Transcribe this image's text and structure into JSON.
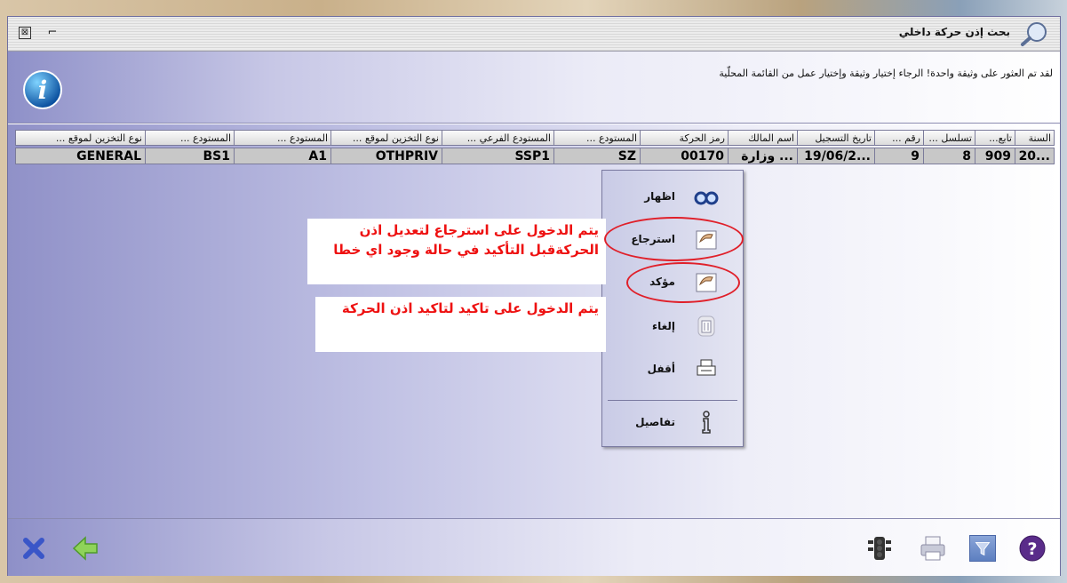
{
  "window": {
    "title": "بحث إذن حركة داخلي"
  },
  "info": {
    "message": "لقد تم العثور على وثيقة واحدة! الرجاء إختيار وثيقة وإختيار عمل من القائمة المحلّية"
  },
  "table": {
    "columns": [
      "السنة",
      "تابع...",
      "تسلسل ...",
      "رقم ...",
      "تاريخ التسجيل",
      "اسم المالك",
      "رمز الحركة",
      "المستودع ...",
      "المستودع الفرعي ...",
      "نوع التخزين لموقع ...",
      "المستودع ...",
      "المستودع ...",
      "نوع التخزين لموقع ..."
    ],
    "rows": [
      [
        "20...",
        "909",
        "8",
        "9",
        "19/06/2...",
        "وزارة ...",
        "00170",
        "SZ",
        "SSP1",
        "OTHPRIV",
        "A1",
        "BS1",
        "GENERAL"
      ]
    ]
  },
  "menu": {
    "items": [
      {
        "label": "اظهار",
        "icon": "glasses-icon"
      },
      {
        "label": "استرجاع",
        "icon": "hand-document-icon"
      },
      {
        "label": "مؤكد",
        "icon": "hand-document-icon"
      },
      {
        "label": "إلغاء",
        "icon": "trash-icon"
      },
      {
        "label": "أقفل",
        "icon": "printer-icon"
      },
      {
        "label": "تفاصيل",
        "icon": "info-outline-icon"
      }
    ]
  },
  "annotations": {
    "note1_line1": "يتم الدخول على استرجاع لتعديل اذن",
    "note1_line2": "الحركةقبل التأكيد في حالة وجود اي خطا",
    "note2": "يتم الدخول على تاكيد لتاكيد اذن الحركة"
  },
  "colors": {
    "accent_red": "#e11111",
    "ellipse": "#e0202a"
  }
}
